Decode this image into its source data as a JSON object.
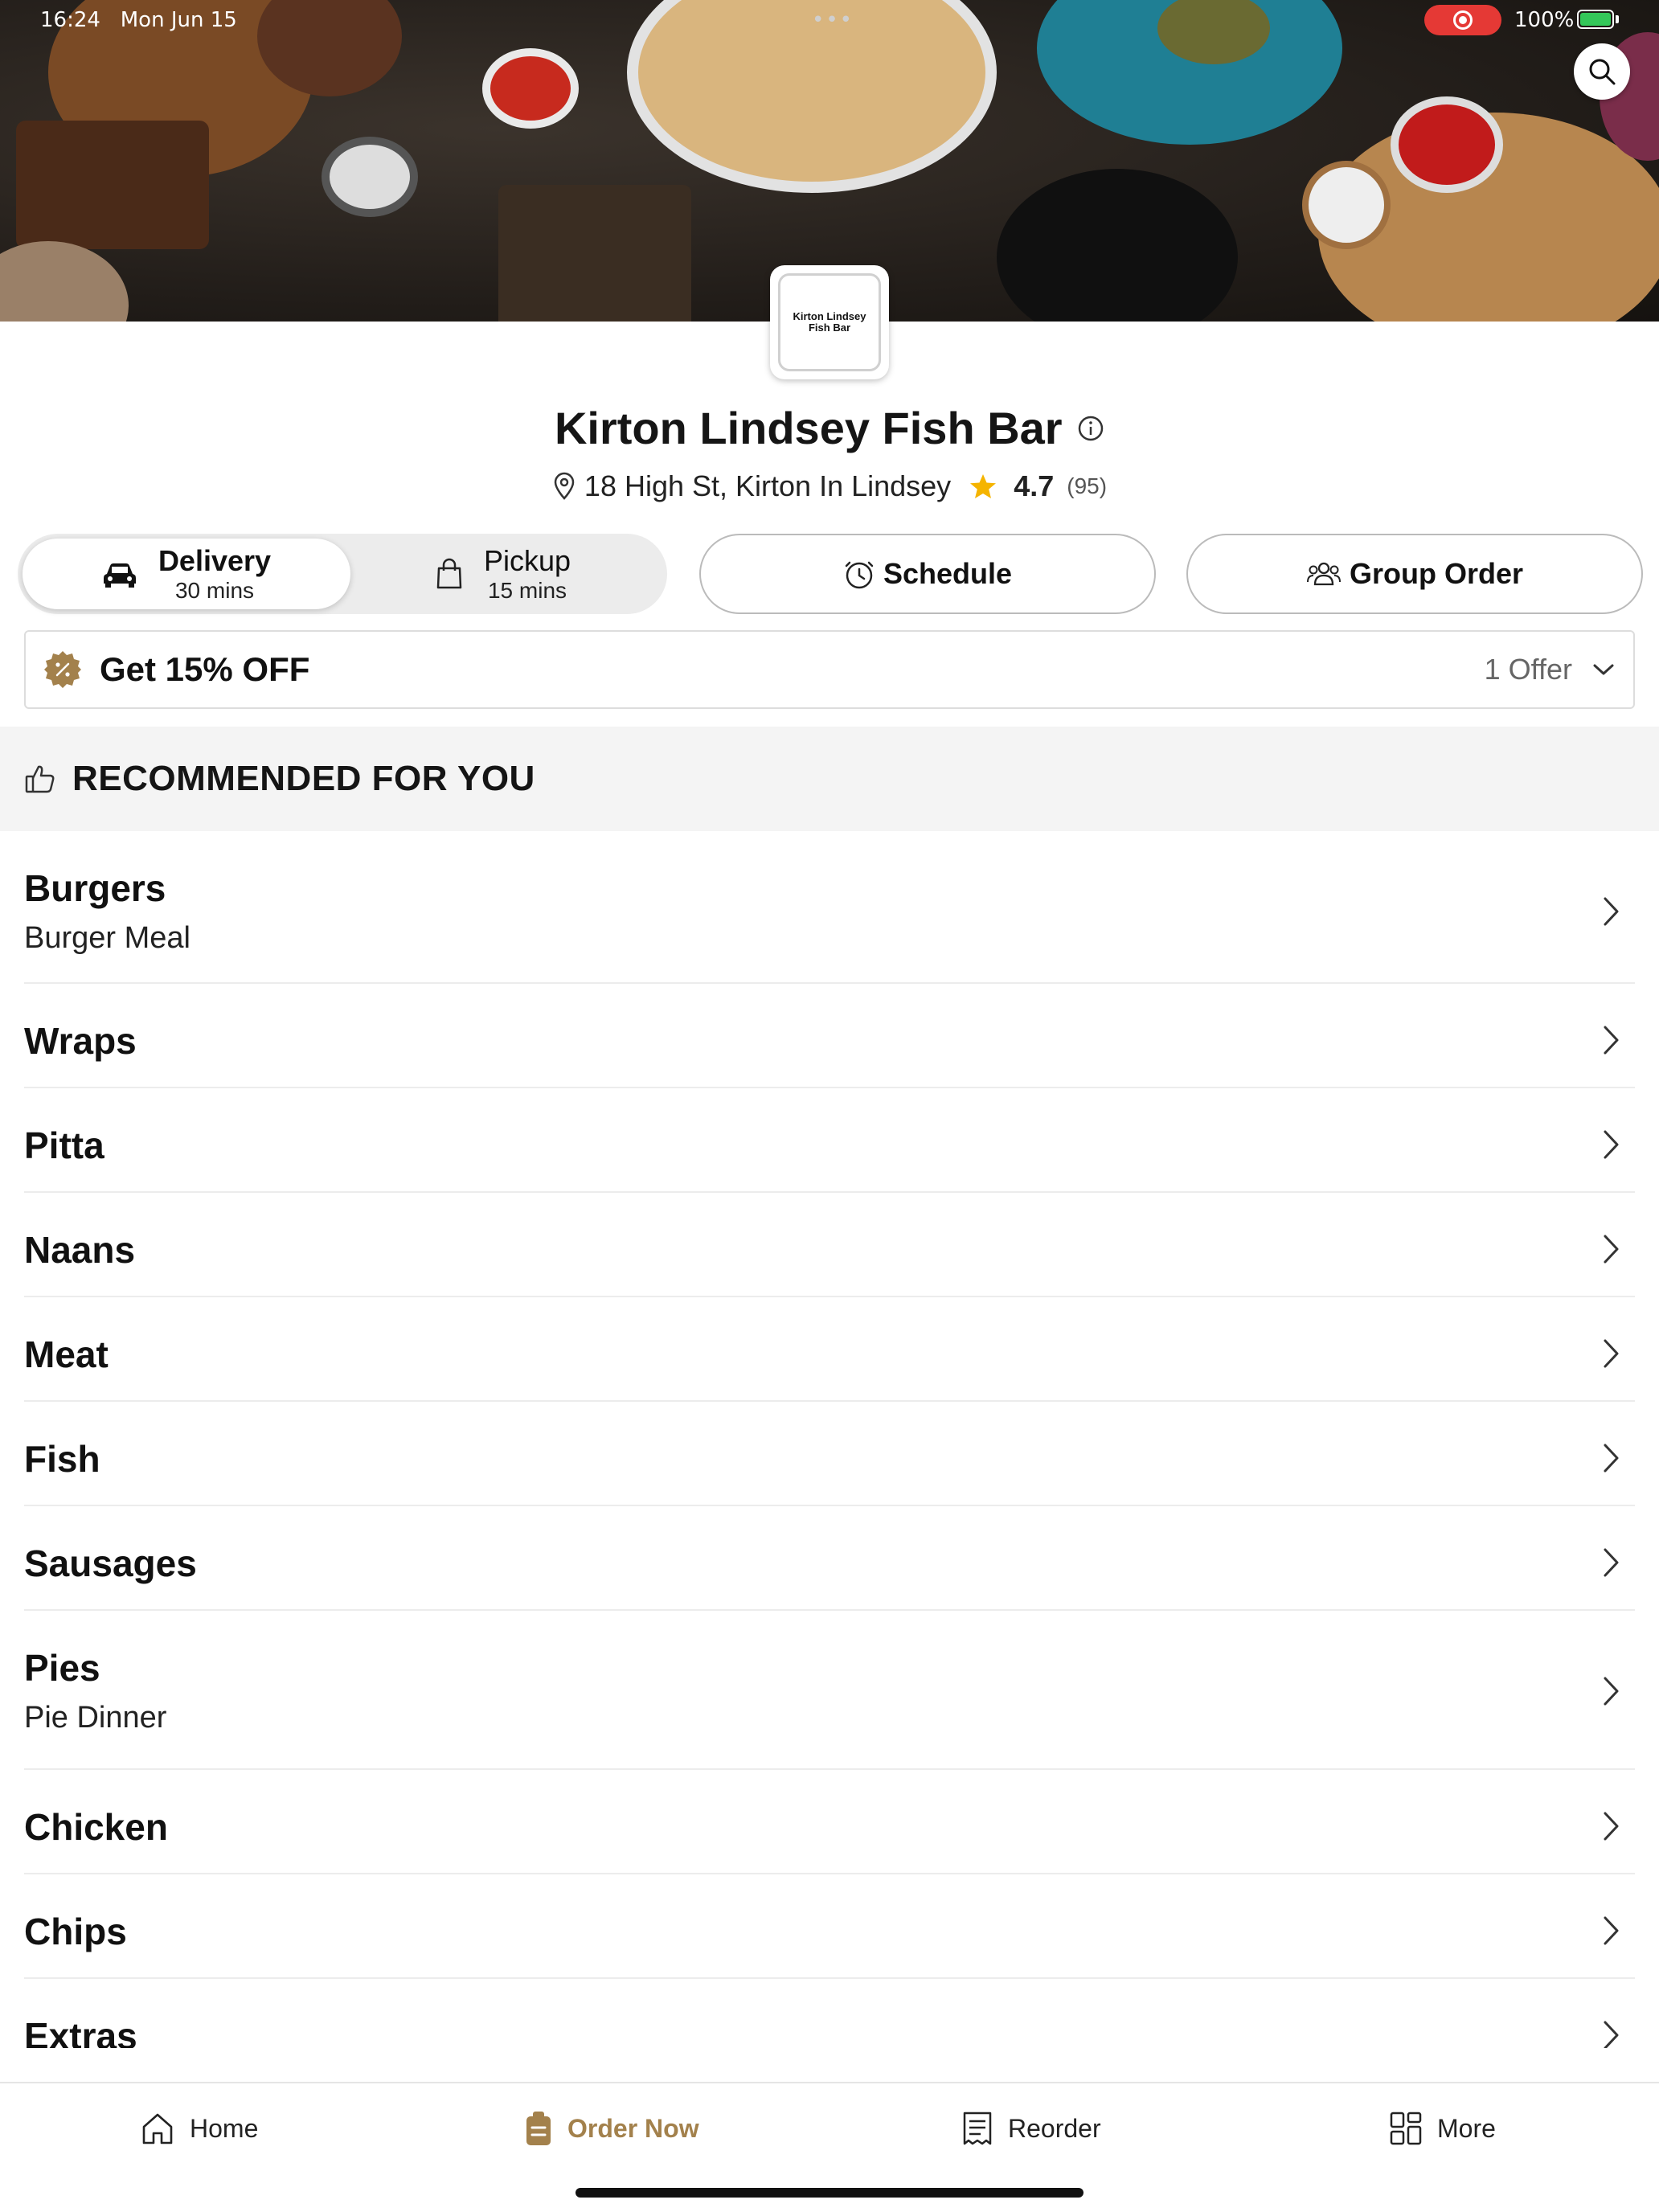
{
  "status_bar": {
    "time": "16:24",
    "date": "Mon Jun 15",
    "battery": "100%"
  },
  "restaurant": {
    "logo_text": "Kirton Lindsey Fish Bar",
    "name": "Kirton Lindsey Fish Bar",
    "address": "18 High St, Kirton In Lindsey",
    "rating": "4.7",
    "reviews": "(95)"
  },
  "order_modes": {
    "delivery": {
      "label": "Delivery",
      "time": "30 mins",
      "selected": true
    },
    "pickup": {
      "label": "Pickup",
      "time": "15 mins",
      "selected": false
    },
    "schedule_label": "Schedule",
    "group_order_label": "Group Order"
  },
  "offer": {
    "title": "Get 15% OFF",
    "count": "1 Offer"
  },
  "section": {
    "title": "RECOMMENDED FOR YOU"
  },
  "categories": [
    {
      "name": "Burgers",
      "subtitle": "Burger Meal"
    },
    {
      "name": "Wraps",
      "subtitle": ""
    },
    {
      "name": "Pitta",
      "subtitle": ""
    },
    {
      "name": "Naans",
      "subtitle": ""
    },
    {
      "name": "Meat",
      "subtitle": ""
    },
    {
      "name": "Fish",
      "subtitle": ""
    },
    {
      "name": "Sausages",
      "subtitle": ""
    },
    {
      "name": "Pies",
      "subtitle": "Pie Dinner"
    },
    {
      "name": "Chicken",
      "subtitle": ""
    },
    {
      "name": "Chips",
      "subtitle": ""
    },
    {
      "name": "Extras",
      "subtitle": ""
    }
  ],
  "bottom_nav": {
    "home": "Home",
    "order_now": "Order Now",
    "reorder": "Reorder",
    "more": "More",
    "active": "order_now"
  },
  "colors": {
    "accent": "#a3814c",
    "star": "#f5b400",
    "record": "#e53935",
    "battery": "#34c759"
  }
}
